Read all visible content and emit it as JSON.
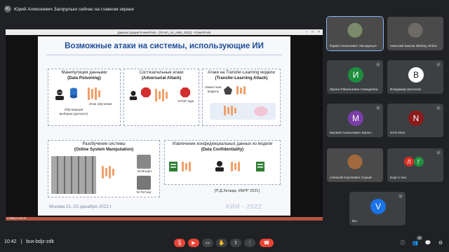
{
  "banner": {
    "avatar": "Ю",
    "text": "Юрий Алексеевич Загорулько сейчас на главном экране"
  },
  "screen": {
    "window_title": "Демонстрация PowerPoint - [Отчёт_по_АИИ_2022] - PowerPoint",
    "taskbar_text": "СЛАЙД 10 ИЗ 20",
    "slide": {
      "title": "Возможные атаки на системы, использующие ИИ",
      "box1": {
        "line1": "Манипуляция данными",
        "line2": "(Data Poisoning)",
        "stage": "Этап обучения",
        "dataset": "Обучающая выборка (датасет)"
      },
      "box2": {
        "line1": "Состязательные атаки",
        "line2": "(Adversarial Attack)",
        "stop": "STOP sign"
      },
      "box3": {
        "line1": "Атаки на Transfer-Learning модели",
        "line2": "(Transfer-Learning Attack)",
        "known": "Известная модель"
      },
      "box4": {
        "line1": "Разобучение системы",
        "line2": "(Online System Manipulation)",
        "monroe": "М.Монро",
        "thatcher": "М.Тетчер"
      },
      "box5": {
        "line1": "Извлечение конфиденциальных данных из модели",
        "line2": "(Data Confidentiality)"
      },
      "reference": "[П.Д.Зегжда, ИБРР 2021]",
      "footer_left": "Москва 21–23 декабря 2022 г.",
      "footer_right": "КИИ - 2022"
    }
  },
  "participants": [
    {
      "name": "Юрий Алексеевич Загорулько",
      "letter": "",
      "color": "#7a8a6a"
    },
    {
      "name": "Николай Шилов Nikolay Shilov",
      "letter": "",
      "color": "#6e6a66"
    },
    {
      "name": "Ирина Равильевна Ахмадеева",
      "letter": "И",
      "color": "#1e8e3e"
    },
    {
      "name": "Владимир Шелехов",
      "letter": "В",
      "color": "#ffffff"
    },
    {
      "name": "Матвей Алексеевич Мальч",
      "letter": "М",
      "color": "#7b3ea8"
    },
    {
      "name": "NVS NVS",
      "letter": "N",
      "color": "#8b1a1a"
    },
    {
      "name": "Алексей Сергеевич Серый",
      "letter": "",
      "color": "#a06a3e"
    },
    {
      "name": "Ещё 2 чел.",
      "letter": "",
      "color": ""
    },
    {
      "name": "Вы",
      "letter": "V",
      "color": "#1a73e8"
    }
  ],
  "bottom": {
    "time": "10:42",
    "separator": "|",
    "meeting_code": "bux-bdjz-zdk",
    "participants_count": "11"
  },
  "icons": [
    "mic-icon",
    "camera-icon",
    "captions-icon",
    "raise-hand-icon",
    "present-icon",
    "more-icon",
    "end-call-icon",
    "info-icon",
    "people-icon",
    "chat-icon",
    "activities-icon"
  ]
}
